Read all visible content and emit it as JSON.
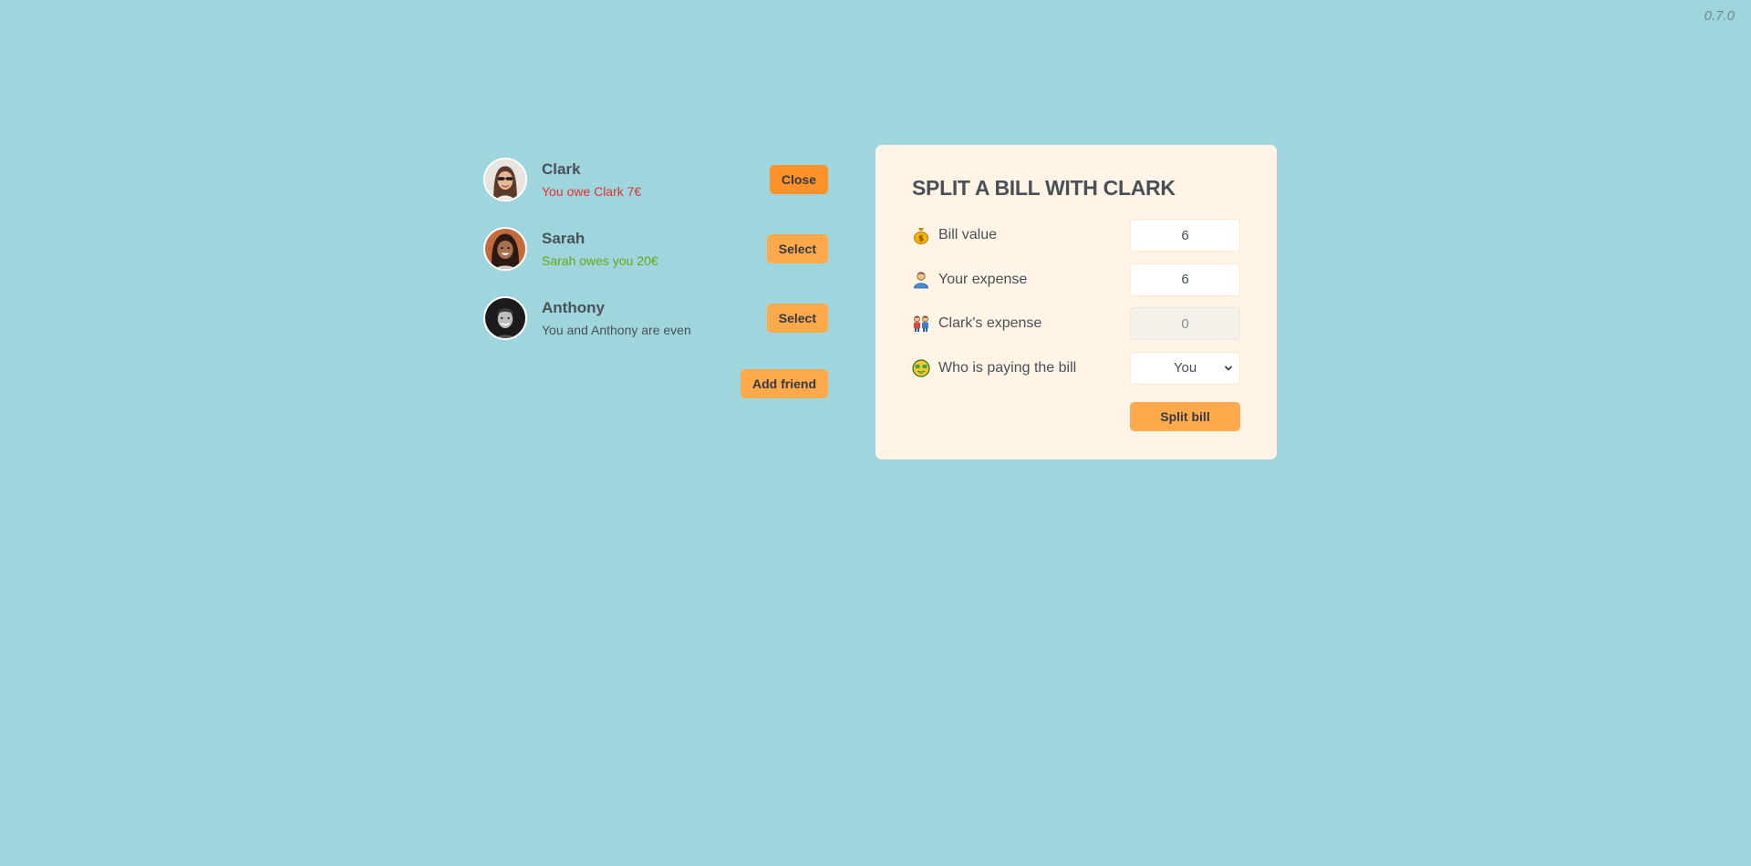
{
  "version": "0.7.0",
  "friends": [
    {
      "name": "Clark",
      "status": "You owe Clark 7€",
      "status_tone": "red",
      "button_label": "Close",
      "avatar_icon": "avatar-woman-sunglasses"
    },
    {
      "name": "Sarah",
      "status": "Sarah owes you 20€",
      "status_tone": "green",
      "button_label": "Select",
      "avatar_icon": "avatar-woman-smiling"
    },
    {
      "name": "Anthony",
      "status": "You and Anthony are even",
      "status_tone": "neutral",
      "button_label": "Select",
      "avatar_icon": "avatar-man-bw"
    }
  ],
  "add_friend_label": "Add friend",
  "form": {
    "title": "SPLIT A BILL WITH CLARK",
    "bill_value": {
      "label": "Bill value",
      "value": "6",
      "icon": "money-bag-icon"
    },
    "your_expense": {
      "label": "Your expense",
      "value": "6",
      "icon": "person-icon"
    },
    "friend_expense": {
      "label": "Clark's expense",
      "value": "0",
      "icon": "people-icon"
    },
    "payer": {
      "label": "Who is paying the bill",
      "selected": "You",
      "icon": "money-face-icon"
    },
    "submit_label": "Split bill"
  },
  "colors": {
    "background": "#9fd6de",
    "panel": "#fff4e6",
    "button": "#ffa94d",
    "button_active": "#ff922b",
    "owe_red": "#e03131",
    "owed_green": "#66a80f"
  }
}
